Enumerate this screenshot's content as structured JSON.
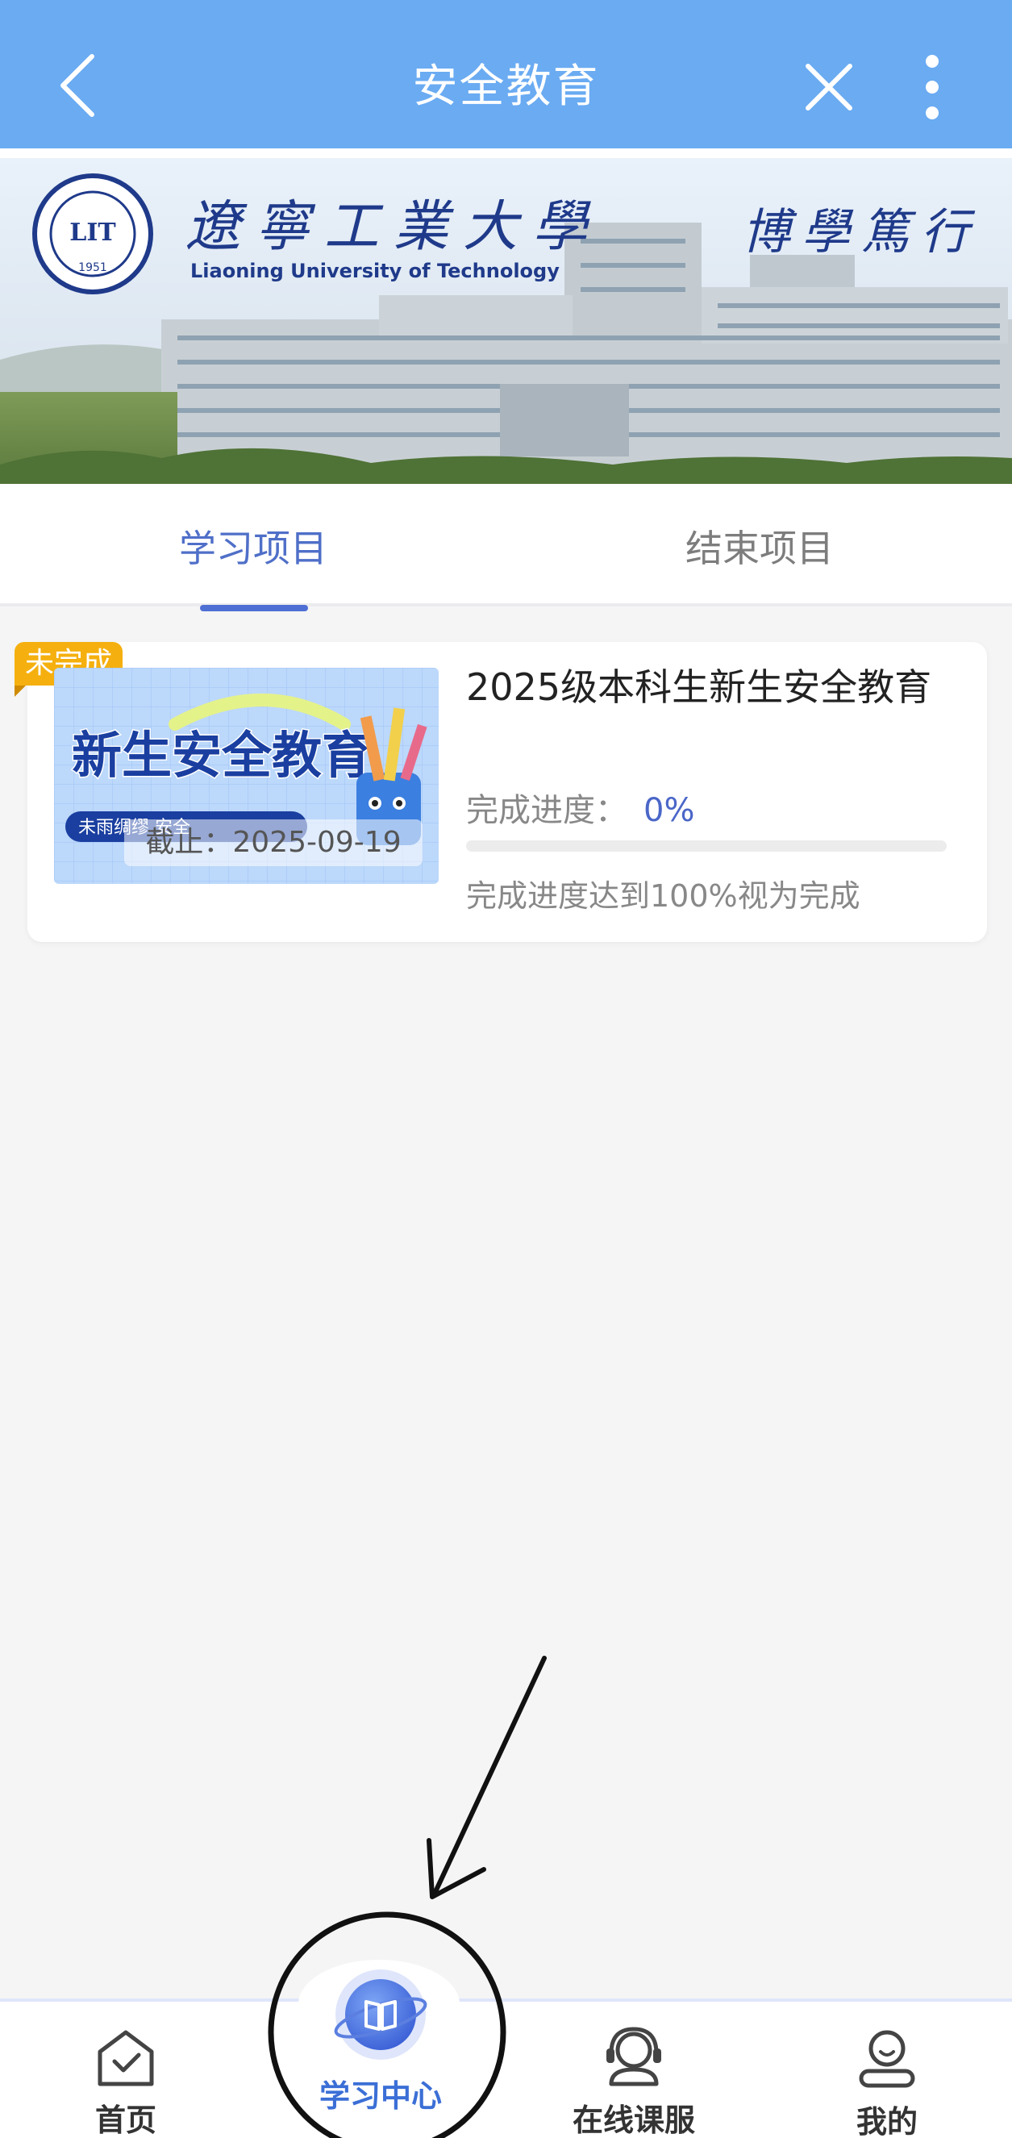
{
  "header": {
    "title": "安全教育",
    "back_icon": "chevron-left-icon",
    "close_icon": "close-icon",
    "more_icon": "more-vertical-icon",
    "background_color": "#6aabf2"
  },
  "banner": {
    "university_cn": "遼寧工業大學",
    "university_en": "Liaoning University of Technology",
    "seal_year": "1951",
    "motto": "博學篤行"
  },
  "tabs": [
    {
      "label": "学习项目",
      "active": true
    },
    {
      "label": "结束项目",
      "active": false
    }
  ],
  "project_card": {
    "status_badge": "未完成",
    "thumbnail_title": "新生安全教育",
    "thumbnail_subtitle": "未雨绸缪 安全",
    "deadline": "截止：2025-09-19",
    "title": "2025级本科生新生安全教育",
    "progress_label": "完成进度：",
    "progress_value": "0%",
    "progress_fraction": 0,
    "completion_note": "完成进度达到100%视为完成"
  },
  "bottom_nav": [
    {
      "label": "首页",
      "icon": "home-check-icon",
      "active": false
    },
    {
      "label": "学习中心",
      "icon": "book-icon",
      "active": true
    },
    {
      "label": "在线课服",
      "icon": "headset-icon",
      "active": false
    },
    {
      "label": "我的",
      "icon": "user-icon",
      "active": false
    }
  ],
  "colors": {
    "accent": "#4a66c8",
    "badge": "#f5b00f",
    "nav_active": "#3b6fd6"
  }
}
